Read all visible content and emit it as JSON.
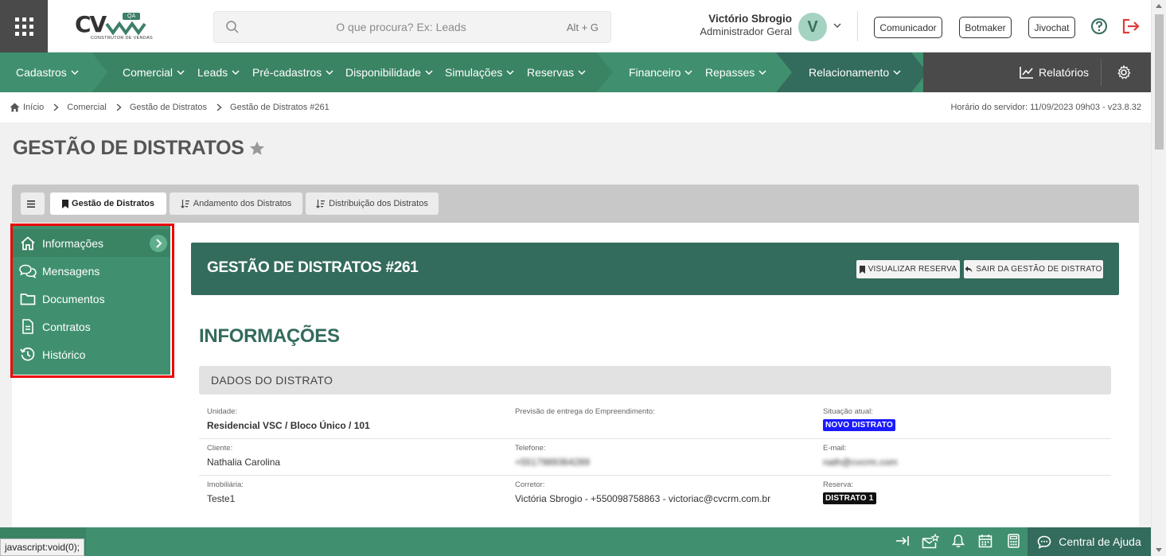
{
  "header": {
    "logo_text": "CV",
    "logo_badge": "QA",
    "logo_subtitle": "CONSTRUTOR DE VENDAS",
    "search_placeholder": "O que procura? Ex: Leads",
    "search_shortcut": "Alt + G",
    "user_name": "Victório Sbrogio",
    "user_role": "Administrador Geral",
    "avatar_letter": "V",
    "buttons": [
      "Comunicador",
      "Botmaker",
      "Jivochat"
    ]
  },
  "nav": {
    "items": [
      "Cadastros",
      "Comercial",
      "Leads",
      "Pré-cadastros",
      "Disponibilidade",
      "Simulações",
      "Reservas",
      "Financeiro",
      "Repasses",
      "Relacionamento"
    ],
    "reports": "Relatórios"
  },
  "breadcrumb": {
    "items": [
      "Início",
      "Comercial",
      "Gestão de Distratos",
      "Gestão de Distratos #261"
    ],
    "server_time": "Horário do servidor: 11/09/2023 09h03 - v23.8.32"
  },
  "page": {
    "title": "GESTÃO DE DISTRATOS"
  },
  "tabs": [
    "Gestão de Distratos",
    "Andamento dos Distratos",
    "Distribuição dos Distratos"
  ],
  "sidemenu": [
    "Informações",
    "Mensagens",
    "Documentos",
    "Contratos",
    "Histórico"
  ],
  "banner": {
    "title": "GESTÃO DE DISTRATOS #261",
    "btn_view": "VISUALIZAR RESERVA",
    "btn_exit": "SAIR DA GESTÃO DE DISTRATO"
  },
  "section": {
    "title": "INFORMAÇÕES",
    "subtitle": "DADOS DO DISTRATO"
  },
  "fields": {
    "unidade_label": "Unidade:",
    "unidade_value": "Residencial VSC / Bloco Único / 101",
    "previsao_label": "Previsão de entrega do Empreendimento:",
    "situacao_label": "Situação atual:",
    "situacao_value": "NOVO DISTRATO",
    "cliente_label": "Cliente:",
    "cliente_value": "Nathalia Carolina",
    "telefone_label": "Telefone:",
    "telefone_value": "+5517989364289",
    "email_label": "E-mail:",
    "email_value": "nath@cvcrm.com",
    "imobiliaria_label": "Imobiliária:",
    "imobiliaria_value": "Teste1",
    "corretor_label": "Corretor:",
    "corretor_value": "Victória Sbrogio - +550098758863 - victoriac@cvcrm.com.br",
    "reserva_label": "Reserva:",
    "reserva_value": "DISTRATO 1"
  },
  "footer": {
    "help": "Central de Ajuda",
    "status_text": "javascript:void(0);"
  },
  "colors": {
    "green": "#40906f",
    "dark_green": "#336b5c",
    "badge_blue": "#1a1aff",
    "badge_black": "#111111",
    "logout_red": "#e23b3b"
  }
}
